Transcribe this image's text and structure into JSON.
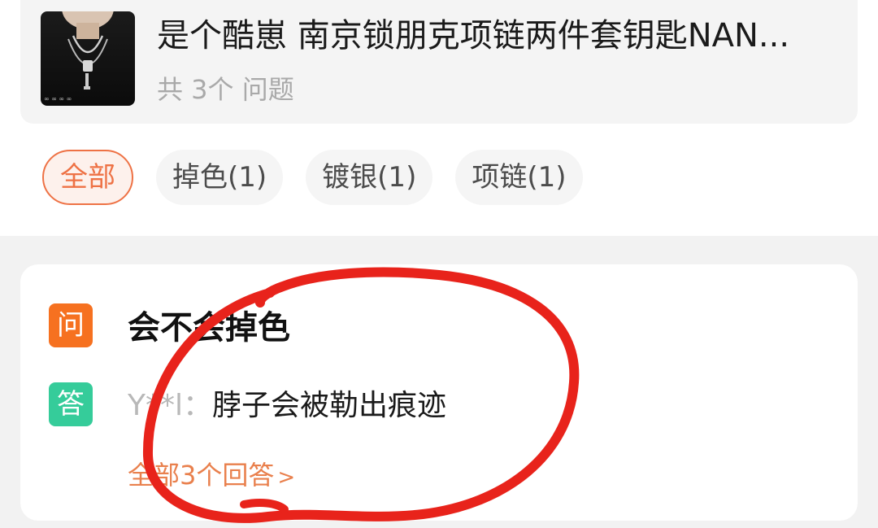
{
  "product": {
    "title": "是个酷崽 南京锁朋克项链两件套钥匙NAN...",
    "question_count": "共 3个 问题",
    "thumbnail_text": "∞ ∞ ∞ ∞"
  },
  "filters": {
    "tags": [
      {
        "label": "全部",
        "active": true
      },
      {
        "label": "掉色(1)",
        "active": false
      },
      {
        "label": "镀银(1)",
        "active": false
      },
      {
        "label": "项链(1)",
        "active": false
      }
    ]
  },
  "qa": {
    "question_badge": "问",
    "question": "会不会掉色",
    "answer_badge": "答",
    "answer_user": "Y**l：",
    "answer": "脖子会被勒出痕迹",
    "all_answers": "全部3个回答",
    "all_answers_chevron": ">"
  },
  "colors": {
    "accent": "#ee7245",
    "question_badge": "#f67120",
    "answer_badge": "#35cc9a",
    "annotation": "#e8231b"
  }
}
